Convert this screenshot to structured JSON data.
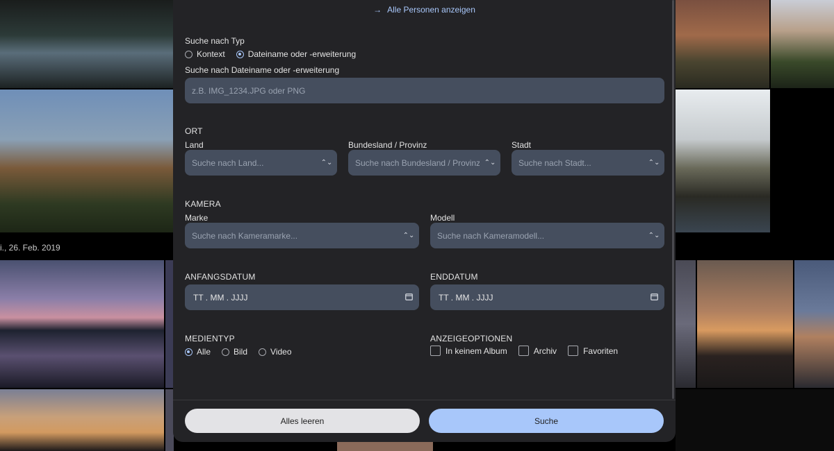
{
  "background": {
    "date_label": "i., 26. Feb. 2019"
  },
  "modal": {
    "show_all_people": "Alle Personen anzeigen",
    "search_type": {
      "title": "Suche nach Typ",
      "options": [
        "Kontext",
        "Dateiname oder -erweiterung"
      ],
      "selected": "Dateiname oder -erweiterung"
    },
    "filename": {
      "label": "Suche nach Dateiname oder -erweiterung",
      "placeholder": "z.B. IMG_1234.JPG oder PNG"
    },
    "location": {
      "title": "ORT",
      "country_label": "Land",
      "country_placeholder": "Suche nach Land...",
      "state_label": "Bundesland / Provinz",
      "state_placeholder": "Suche nach Bundesland / Provinz",
      "city_label": "Stadt",
      "city_placeholder": "Suche nach Stadt..."
    },
    "camera": {
      "title": "KAMERA",
      "make_label": "Marke",
      "make_placeholder": "Suche nach Kameramarke...",
      "model_label": "Modell",
      "model_placeholder": "Suche nach Kameramodell..."
    },
    "start_date": {
      "title": "ANFANGSDATUM",
      "placeholder": "TT . MM . JJJJ"
    },
    "end_date": {
      "title": "ENDDATUM",
      "placeholder": "TT . MM . JJJJ"
    },
    "media_type": {
      "title": "MEDIENTYP",
      "options": [
        "Alle",
        "Bild",
        "Video"
      ],
      "selected": "Alle"
    },
    "display_options": {
      "title": "ANZEIGEOPTIONEN",
      "options": [
        "In keinem Album",
        "Archiv",
        "Favoriten"
      ],
      "checked": []
    },
    "buttons": {
      "clear": "Alles leeren",
      "search": "Suche"
    },
    "colors": {
      "accent": "#a8c7fa",
      "surface": "#232326",
      "field": "#454e5e"
    }
  }
}
